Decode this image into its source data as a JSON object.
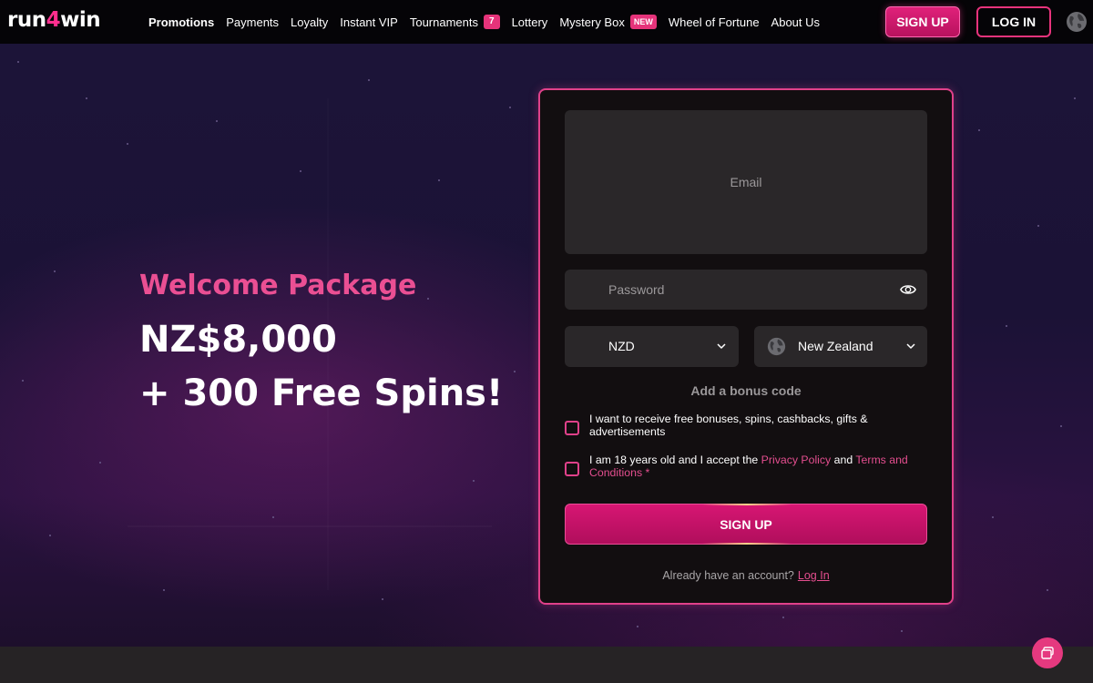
{
  "brand": {
    "logo_part1": "run",
    "logo_part2": "4",
    "logo_part3": "win"
  },
  "nav": {
    "items": [
      {
        "label": "Promotions",
        "active": true
      },
      {
        "label": "Payments"
      },
      {
        "label": "Loyalty"
      },
      {
        "label": "Instant VIP"
      },
      {
        "label": "Tournaments",
        "badge": "7"
      },
      {
        "label": "Lottery"
      },
      {
        "label": "Mystery Box",
        "badge": "NEW"
      },
      {
        "label": "Wheel of Fortune"
      },
      {
        "label": "About Us"
      }
    ],
    "signup_label": "SIGN UP",
    "login_label": "LOG IN"
  },
  "hero": {
    "welcome": "Welcome Package",
    "amount": "NZ$8,000",
    "spins": "+ 300 Free Spins!"
  },
  "form": {
    "email_placeholder": "Email",
    "password_placeholder": "Password",
    "currency": "NZD",
    "country": "New Zealand",
    "bonus_code": "Add a bonus code",
    "consent_marketing": "I want to receive free bonuses, spins, cashbacks, gifts & advertisements",
    "consent_age_prefix": "I am 18 years old and I accept the ",
    "privacy_policy": "Privacy Policy",
    "and": " and ",
    "terms": "Terms and Conditions",
    "required_mark": " *",
    "signup_button": "SIGN UP",
    "already_text": "Already have an account?",
    "login_link": "Log In"
  },
  "colors": {
    "accent": "#e0418a",
    "button_pink": "#d71673",
    "header_bg": "#050407",
    "field_bg": "#2a2729"
  },
  "icons": {
    "password_toggle": "eye-icon",
    "language": "globe-icon",
    "country_flag": "globe-icon",
    "dropdown": "chevron-down-icon",
    "chat": "chat-icon"
  }
}
